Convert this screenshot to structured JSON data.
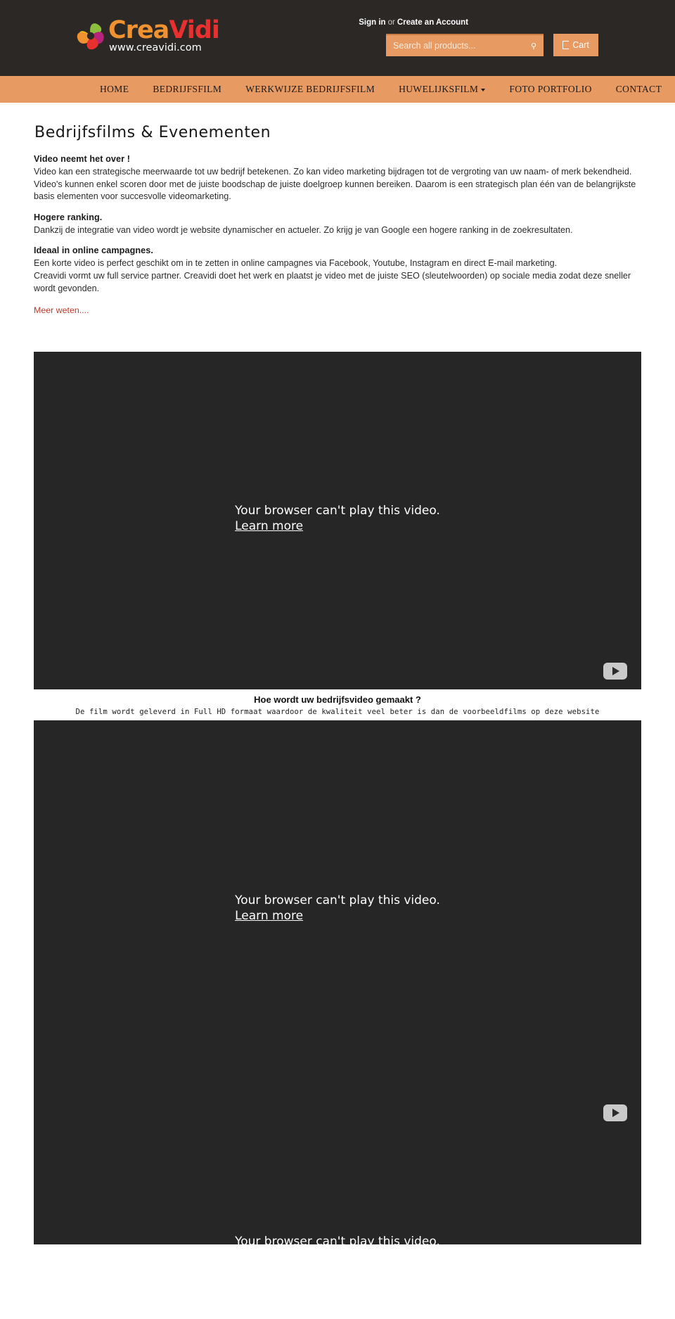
{
  "header": {
    "logo": {
      "word_part1": "Crea",
      "word_part2": "Vidi",
      "url": "www.creavidi.com",
      "mark_icon": "spiral-flower-icon"
    },
    "account": {
      "sign_in": "Sign in",
      "separator": "or",
      "create_account": "Create an Account"
    },
    "search": {
      "placeholder": "Search all products...",
      "value": "",
      "button_icon": "search-icon",
      "button_glyph": "⚲"
    },
    "cart": {
      "label": "Cart",
      "icon": "cart-icon"
    }
  },
  "nav": {
    "items": [
      {
        "label": "HOME",
        "has_dropdown": false
      },
      {
        "label": "BEDRIJFSFILM",
        "has_dropdown": false
      },
      {
        "label": "WERKWIJZE BEDRIJFSFILM",
        "has_dropdown": false
      },
      {
        "label": "HUWELIJKSFILM",
        "has_dropdown": true
      },
      {
        "label": "FOTO PORTFOLIO",
        "has_dropdown": false
      },
      {
        "label": "CONTACT",
        "has_dropdown": false
      }
    ]
  },
  "main": {
    "title": "Bedrijfsfilms  &  Evenementen",
    "blocks": [
      {
        "heading": "Video neemt het over !",
        "lines": [
          "Video kan een strategische meerwaarde tot uw bedrijf betekenen. Zo kan video marketing bijdragen tot de vergroting van uw naam- of merk bekendheid.",
          "Video's kunnen enkel scoren door met de juiste boodschap de juiste doelgroep kunnen bereiken. Daarom is een strategisch plan één van de belangrijkste",
          "basis elementen voor succesvolle videomarketing."
        ]
      },
      {
        "heading": "Hogere ranking.",
        "lines": [
          "Dankzij de integratie van video wordt je website dynamischer en actueler. Zo krijg je van Google een hogere ranking in de zoekresultaten."
        ]
      },
      {
        "heading": "Ideaal in online campagnes.",
        "lines": [
          "Een korte video is perfect geschikt om in te zetten in online campagnes via Facebook, Youtube, Instagram en direct E-mail marketing.",
          "Creavidi vormt uw full service partner. Creavidi doet het werk en plaatst je video met de juiste SEO (sleutelwoorden) op sociale media zodat deze sneller",
          "wordt gevonden."
        ]
      }
    ],
    "more_link": "Meer weten...."
  },
  "videos": {
    "error_text": "Your browser can't play this video.",
    "learn_more": "Learn more",
    "play_icon": "play-button-icon",
    "player1": {
      "name": "bedrijfsvideo-player-1"
    },
    "player2": {
      "name": "bedrijfsvideo-player-2"
    }
  },
  "captions": {
    "headline": "Hoe wordt uw bedrijfsvideo gemaakt ?",
    "subline": "De film wordt geleverd in Full HD formaat waardoor de kwaliteit veel beter is dan de voorbeeldfilms op deze website"
  },
  "colors": {
    "header_bg": "#2b2826",
    "accent": "#e89a63",
    "link_red": "#c0392b",
    "video_bg": "#262626"
  }
}
